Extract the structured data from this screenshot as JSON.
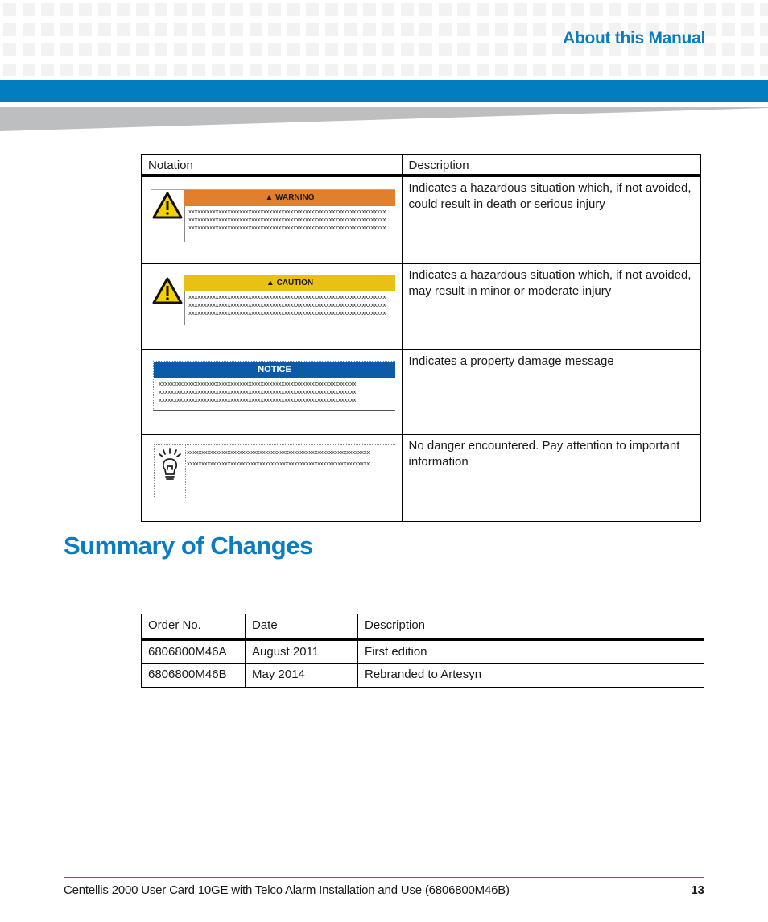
{
  "header": {
    "section": "About this Manual",
    "colors": {
      "accent": "#027dbf",
      "title": "#0a7cbf",
      "band_gray": "#bdbebf"
    }
  },
  "notation_table": {
    "headers": [
      "Notation",
      "Description"
    ],
    "rows": [
      {
        "sign": "warning",
        "sign_label": "WARNING",
        "sign_color": "#e27f2d",
        "placeholder_text": "xxxxxxxxxxxxxxxxxxxxxxxxxxxxxxxxxxxxxxxxxxxxxxxxxxxxxxxxxxxxxxxxxx",
        "description": "Indicates a hazardous situation which, if not avoided, could result in death or serious injury"
      },
      {
        "sign": "caution",
        "sign_label": "CAUTION",
        "sign_color": "#e9c114",
        "placeholder_text": "xxxxxxxxxxxxxxxxxxxxxxxxxxxxxxxxxxxxxxxxxxxxxxxxxxxxxxxxxxxxxxxxxx",
        "description": "Indicates a hazardous situation which, if not avoided, may result in minor or moderate injury"
      },
      {
        "sign": "notice",
        "sign_label": "NOTICE",
        "sign_color": "#0a5ca9",
        "placeholder_text": "xxxxxxxxxxxxxxxxxxxxxxxxxxxxxxxxxxxxxxxxxxxxxxxxxxxxxxxxxxxxxxxxxx",
        "description": "Indicates a property damage message"
      },
      {
        "sign": "tip",
        "sign_label": "",
        "sign_color": "",
        "placeholder_text": "xxxxxxxxxxxxxxxxxxxxxxxxxxxxxxxxxxxxxxxxxxxxxxxxxxxxxxxxxxxxxxx",
        "description": "No danger encountered. Pay attention to important information"
      }
    ]
  },
  "summary": {
    "title": "Summary of Changes",
    "headers": [
      "Order No.",
      "Date",
      "Description"
    ],
    "rows": [
      [
        "6806800M46A",
        "August 2011",
        "First edition"
      ],
      [
        "6806800M46B",
        "May 2014",
        "Rebranded to Artesyn"
      ]
    ]
  },
  "footer": {
    "document_title": "Centellis 2000 User Card 10GE with Telco Alarm Installation and Use (6806800M46B)",
    "page_number": "13"
  }
}
